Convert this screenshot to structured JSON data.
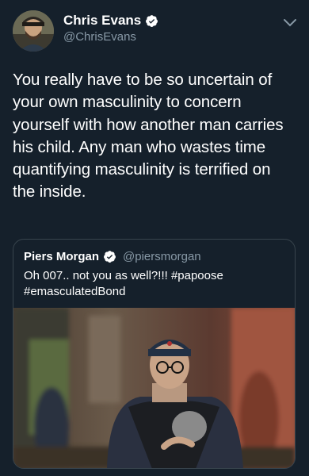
{
  "tweet": {
    "author_name": "Chris Evans",
    "author_handle": "@ChrisEvans",
    "lines": [
      "You really have to be so uncertain of",
      "your own masculinity to concern",
      "yourself with how another man carries",
      "his child. Any man who wastes time",
      "quantifying masculinity is terrified on",
      "the inside."
    ]
  },
  "quoted_tweet": {
    "author_name": "Piers Morgan",
    "author_handle": "@piersmorgan",
    "lines": [
      "Oh 007.. not you as well?!!! #papoose",
      "#emasculatedBond"
    ]
  },
  "icons": {
    "verified": "verified-badge-icon",
    "menu": "chevron-down-icon"
  },
  "colors": {
    "background": "#15202b",
    "secondary_text": "#8899a6",
    "verified_badge": "#ffffff",
    "border": "#38444d"
  }
}
